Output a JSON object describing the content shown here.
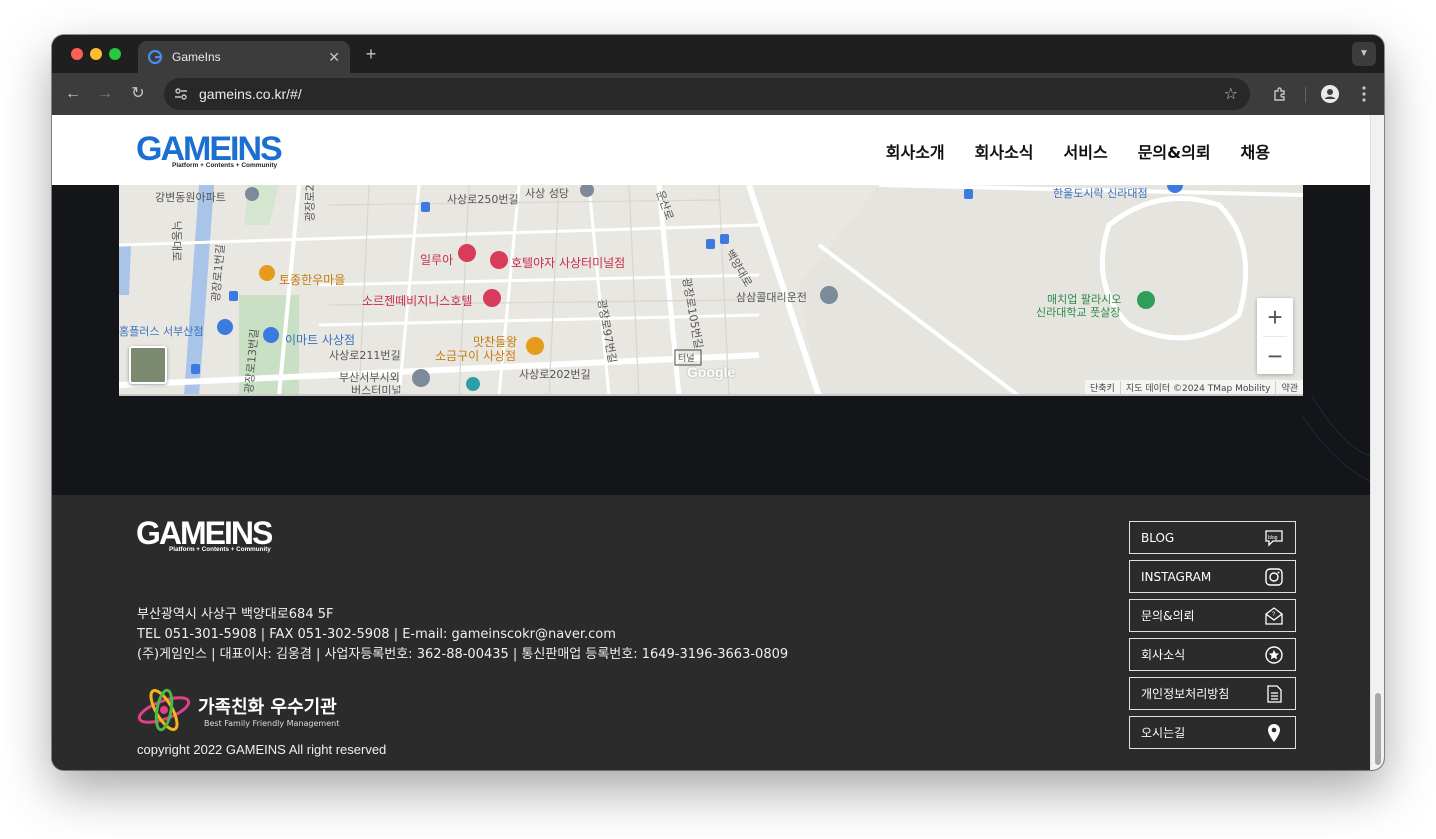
{
  "browser": {
    "tab_title": "GameIns",
    "url": "gameins.co.kr/#/"
  },
  "header": {
    "logo_text": "GAMEINS",
    "logo_tagline": "Platform + Contents + Community",
    "nav": [
      "회사소개",
      "회사소식",
      "서비스",
      "문의&의뢰",
      "채용"
    ]
  },
  "map": {
    "labels": {
      "l1": "강변동원아파트",
      "l2": "사상로250번길",
      "l3": "사상 성당",
      "l4": "운산로",
      "l5": "일루아",
      "l6": "호텔야자 사상터미널점",
      "l7": "토종한우마을",
      "l8": "소르젠떼비지니스호텔",
      "l9": "삼삼콜대리운전",
      "l10": "매치업 팔라시오",
      "l11": "신라대학교 풋살장",
      "l12": "홈플러스 서부산점",
      "l13": "이마트 사상점",
      "l14": "맛찬들왕",
      "l15": "소금구이 사상점",
      "l16": "사상로211번길",
      "l17": "부산서부시외",
      "l18": "버스터미널",
      "l19": "사상로202번길",
      "l20": "터널",
      "l21": "낙동대로",
      "l22": "광장로2",
      "l23": "백양대로",
      "l24": "광장로105번길",
      "l25": "광장로97번길",
      "l26": "광장로13번길",
      "l27": "광장로1번길",
      "l28": "한울도시락 신라대점"
    },
    "zoom_in": "+",
    "zoom_out": "−",
    "google": "Google",
    "attribution": [
      "단축키",
      "지도 데이터 ©2024 TMap Mobility",
      "약관"
    ]
  },
  "footer": {
    "logo_text": "GAMEINS",
    "logo_tagline": "Platform + Contents + Community",
    "address": "부산광역시 사상구 백양대로684 5F",
    "contact": "TEL 051-301-5908 | FAX 051-302-5908 | E-mail: gameinscokr@naver.com",
    "company": "(주)게임인스 | 대표이사: 김웅겸 | 사업자등록번호: 362-88-00435 | 통신판매업 등록번호: 1649-3196-3663-0809",
    "family_title": "가족친화 우수기관",
    "family_sub": "Best Family Friendly Management",
    "copyright": "copyright 2022 GAMEINS All right reserved",
    "links": [
      {
        "label": "BLOG",
        "icon": "blog-icon"
      },
      {
        "label": "INSTAGRAM",
        "icon": "instagram-icon"
      },
      {
        "label": "문의&의뢰",
        "icon": "mail-icon"
      },
      {
        "label": "회사소식",
        "icon": "news-icon"
      },
      {
        "label": "개인정보처리방침",
        "icon": "document-icon"
      },
      {
        "label": "오시는길",
        "icon": "location-pin-icon"
      }
    ]
  },
  "colors": {
    "brand_blue": "#1a6fd1",
    "footer_bg": "#2b2b2b",
    "dark_bg": "#141519"
  }
}
